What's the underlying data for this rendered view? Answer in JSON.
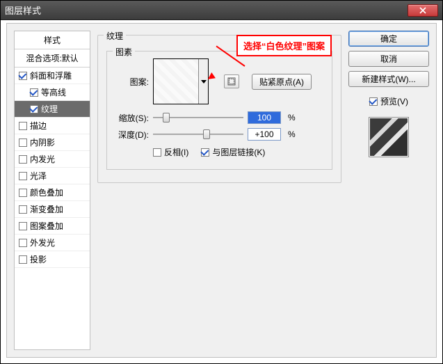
{
  "window": {
    "title": "图层样式"
  },
  "styles": {
    "header": "样式",
    "blend": "混合选项:默认",
    "items": [
      {
        "label": "斜面和浮雕",
        "checked": true,
        "indent": false,
        "selected": false
      },
      {
        "label": "等高线",
        "checked": true,
        "indent": true,
        "selected": false
      },
      {
        "label": "纹理",
        "checked": true,
        "indent": true,
        "selected": true
      },
      {
        "label": "描边",
        "checked": false,
        "indent": false,
        "selected": false
      },
      {
        "label": "内阴影",
        "checked": false,
        "indent": false,
        "selected": false
      },
      {
        "label": "内发光",
        "checked": false,
        "indent": false,
        "selected": false
      },
      {
        "label": "光泽",
        "checked": false,
        "indent": false,
        "selected": false
      },
      {
        "label": "颜色叠加",
        "checked": false,
        "indent": false,
        "selected": false
      },
      {
        "label": "渐变叠加",
        "checked": false,
        "indent": false,
        "selected": false
      },
      {
        "label": "图案叠加",
        "checked": false,
        "indent": false,
        "selected": false
      },
      {
        "label": "外发光",
        "checked": false,
        "indent": false,
        "selected": false
      },
      {
        "label": "投影",
        "checked": false,
        "indent": false,
        "selected": false
      }
    ]
  },
  "texture": {
    "group_label": "纹理",
    "element_label": "图素",
    "pattern_label": "图案:",
    "snap_btn": "贴紧原点(A)",
    "scale_label": "缩放(S):",
    "scale_value": "100",
    "depth_label": "深度(D):",
    "depth_value": "+100",
    "percent": "%",
    "invert_label": "反相(I)",
    "invert_checked": false,
    "link_label": "与图层链接(K)",
    "link_checked": true
  },
  "callout": {
    "text": "选择“白色纹理”图案"
  },
  "buttons": {
    "ok": "确定",
    "cancel": "取消",
    "new_style": "新建样式(W)...",
    "preview": "预览(V)",
    "preview_checked": true
  }
}
